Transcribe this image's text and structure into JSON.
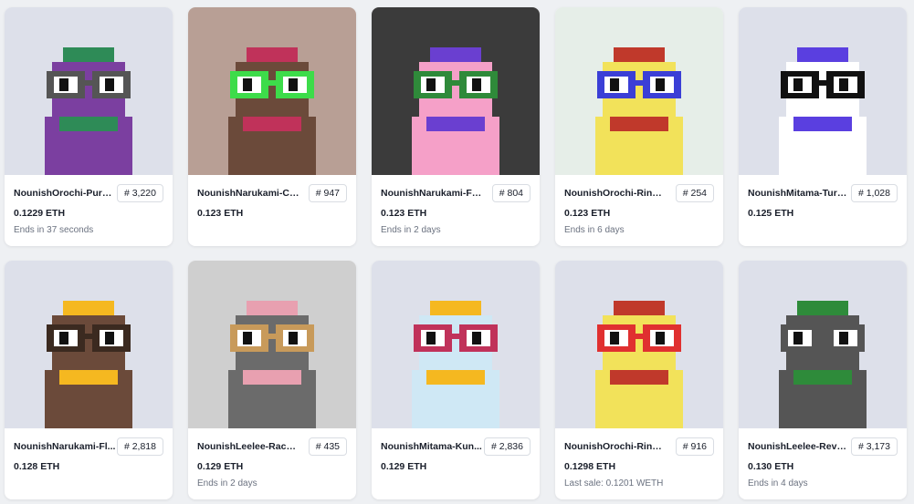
{
  "cards": [
    {
      "name": "NounishOrochi-Purpl...",
      "number": "# 3,220",
      "price": "0.1229 ETH",
      "sub": "Ends in 37 seconds",
      "bg": "#dde0ea",
      "body": "#7b3fa0",
      "accent": "#2e8b57",
      "glasses": "#555555"
    },
    {
      "name": "NounishNarukami-Ch...",
      "number": "# 947",
      "price": "0.123 ETH",
      "sub": "",
      "bg": "#b89f95",
      "body": "#6b4a3a",
      "accent": "#c0325a",
      "glasses": "#3ddc4a"
    },
    {
      "name": "NounishNarukami-Fla...",
      "number": "# 804",
      "price": "0.123 ETH",
      "sub": "Ends in 2 days",
      "bg": "#3b3b3b",
      "body": "#f5a0c8",
      "accent": "#6a3fd0",
      "glasses": "#2f8a3a"
    },
    {
      "name": "NounishOrochi-Ringed...",
      "number": "# 254",
      "price": "0.123 ETH",
      "sub": "Ends in 6 days",
      "bg": "#e6eee8",
      "body": "#f2e25a",
      "accent": "#c0392b",
      "glasses": "#3b3fd6"
    },
    {
      "name": "NounishMitama-Turn...",
      "number": "# 1,028",
      "price": "0.125 ETH",
      "sub": "",
      "bg": "#dde0ea",
      "body": "#ffffff",
      "accent": "#5a3fe0",
      "glasses": "#111111"
    },
    {
      "name": "NounishNarukami-Fl...",
      "number": "# 2,818",
      "price": "0.128 ETH",
      "sub": "",
      "bg": "#dde0ea",
      "body": "#6b4a3a",
      "accent": "#f5b820",
      "glasses": "#3b2a20"
    },
    {
      "name": "NounishLeelee-Raccoo...",
      "number": "# 435",
      "price": "0.129 ETH",
      "sub": "Ends in 2 days",
      "bg": "#cfcfcf",
      "body": "#6b6b6b",
      "accent": "#e8a0b0",
      "glasses": "#c89a5a"
    },
    {
      "name": "NounishMitama-Kun...",
      "number": "# 2,836",
      "price": "0.129 ETH",
      "sub": "",
      "bg": "#dde0ea",
      "body": "#cfe8f5",
      "accent": "#f5b820",
      "glasses": "#c0325a"
    },
    {
      "name": "NounishOrochi-Ringed ...",
      "number": "# 916",
      "price": "0.1298 ETH",
      "sub": "Last sale: 0.1201 WETH",
      "bg": "#dde0ea",
      "body": "#f2e25a",
      "accent": "#c0392b",
      "glasses": "#e03030"
    },
    {
      "name": "NounishLeelee-Rever...",
      "number": "# 3,173",
      "price": "0.130 ETH",
      "sub": "Ends in 4 days",
      "bg": "#dde0ea",
      "body": "#555555",
      "accent": "#2e8b3a",
      "glasses": "#555555"
    }
  ]
}
